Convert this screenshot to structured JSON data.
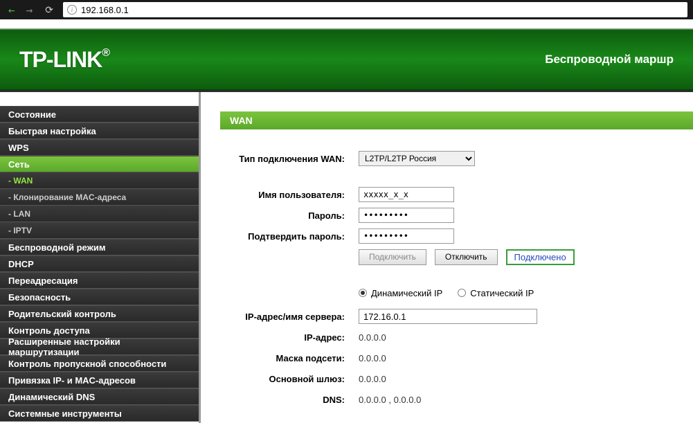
{
  "browser": {
    "url": "192.168.0.1"
  },
  "header": {
    "logo": "TP-LINK",
    "reg": "®",
    "tagline": "Беспроводной маршр"
  },
  "sidebar": {
    "items": [
      {
        "label": "Состояние",
        "type": "main"
      },
      {
        "label": "Быстрая настройка",
        "type": "main"
      },
      {
        "label": "WPS",
        "type": "main"
      },
      {
        "label": "Сеть",
        "type": "main",
        "active": true
      },
      {
        "label": "- WAN",
        "type": "sub",
        "active": true
      },
      {
        "label": "- Клонирование MAC-адреса",
        "type": "sub"
      },
      {
        "label": "- LAN",
        "type": "sub"
      },
      {
        "label": "- IPTV",
        "type": "sub"
      },
      {
        "label": "Беспроводной режим",
        "type": "main"
      },
      {
        "label": "DHCP",
        "type": "main"
      },
      {
        "label": "Переадресация",
        "type": "main"
      },
      {
        "label": "Безопасность",
        "type": "main"
      },
      {
        "label": "Родительский контроль",
        "type": "main"
      },
      {
        "label": "Контроль доступа",
        "type": "main"
      },
      {
        "label": "Расширенные настройки маршрутизации",
        "type": "main"
      },
      {
        "label": "Контроль пропускной способности",
        "type": "main"
      },
      {
        "label": "Привязка IP- и MAC-адресов",
        "type": "main"
      },
      {
        "label": "Динамический DNS",
        "type": "main"
      },
      {
        "label": "Системные инструменты",
        "type": "main"
      }
    ]
  },
  "page": {
    "title": "WAN",
    "labels": {
      "conn_type": "Тип подключения WAN:",
      "username": "Имя пользователя:",
      "password": "Пароль:",
      "confirm": "Подтвердить пароль:",
      "server": "IP-адрес/имя сервера:",
      "ip": "IP-адрес:",
      "mask": "Маска подсети:",
      "gateway": "Основной шлюз:",
      "dns": "DNS:"
    },
    "values": {
      "conn_type": "L2TP/L2TP Россия",
      "username": "xxxxx_x_x",
      "password": "•••••••••",
      "confirm": "•••••••••",
      "server": "172.16.0.1",
      "ip": "0.0.0.0",
      "mask": "0.0.0.0",
      "gateway": "0.0.0.0",
      "dns": "0.0.0.0 , 0.0.0.0"
    },
    "buttons": {
      "connect": "Подключить",
      "disconnect": "Отключить"
    },
    "status": "Подключено",
    "radios": {
      "dynamic": "Динамический IP",
      "static": "Статический IP"
    }
  }
}
